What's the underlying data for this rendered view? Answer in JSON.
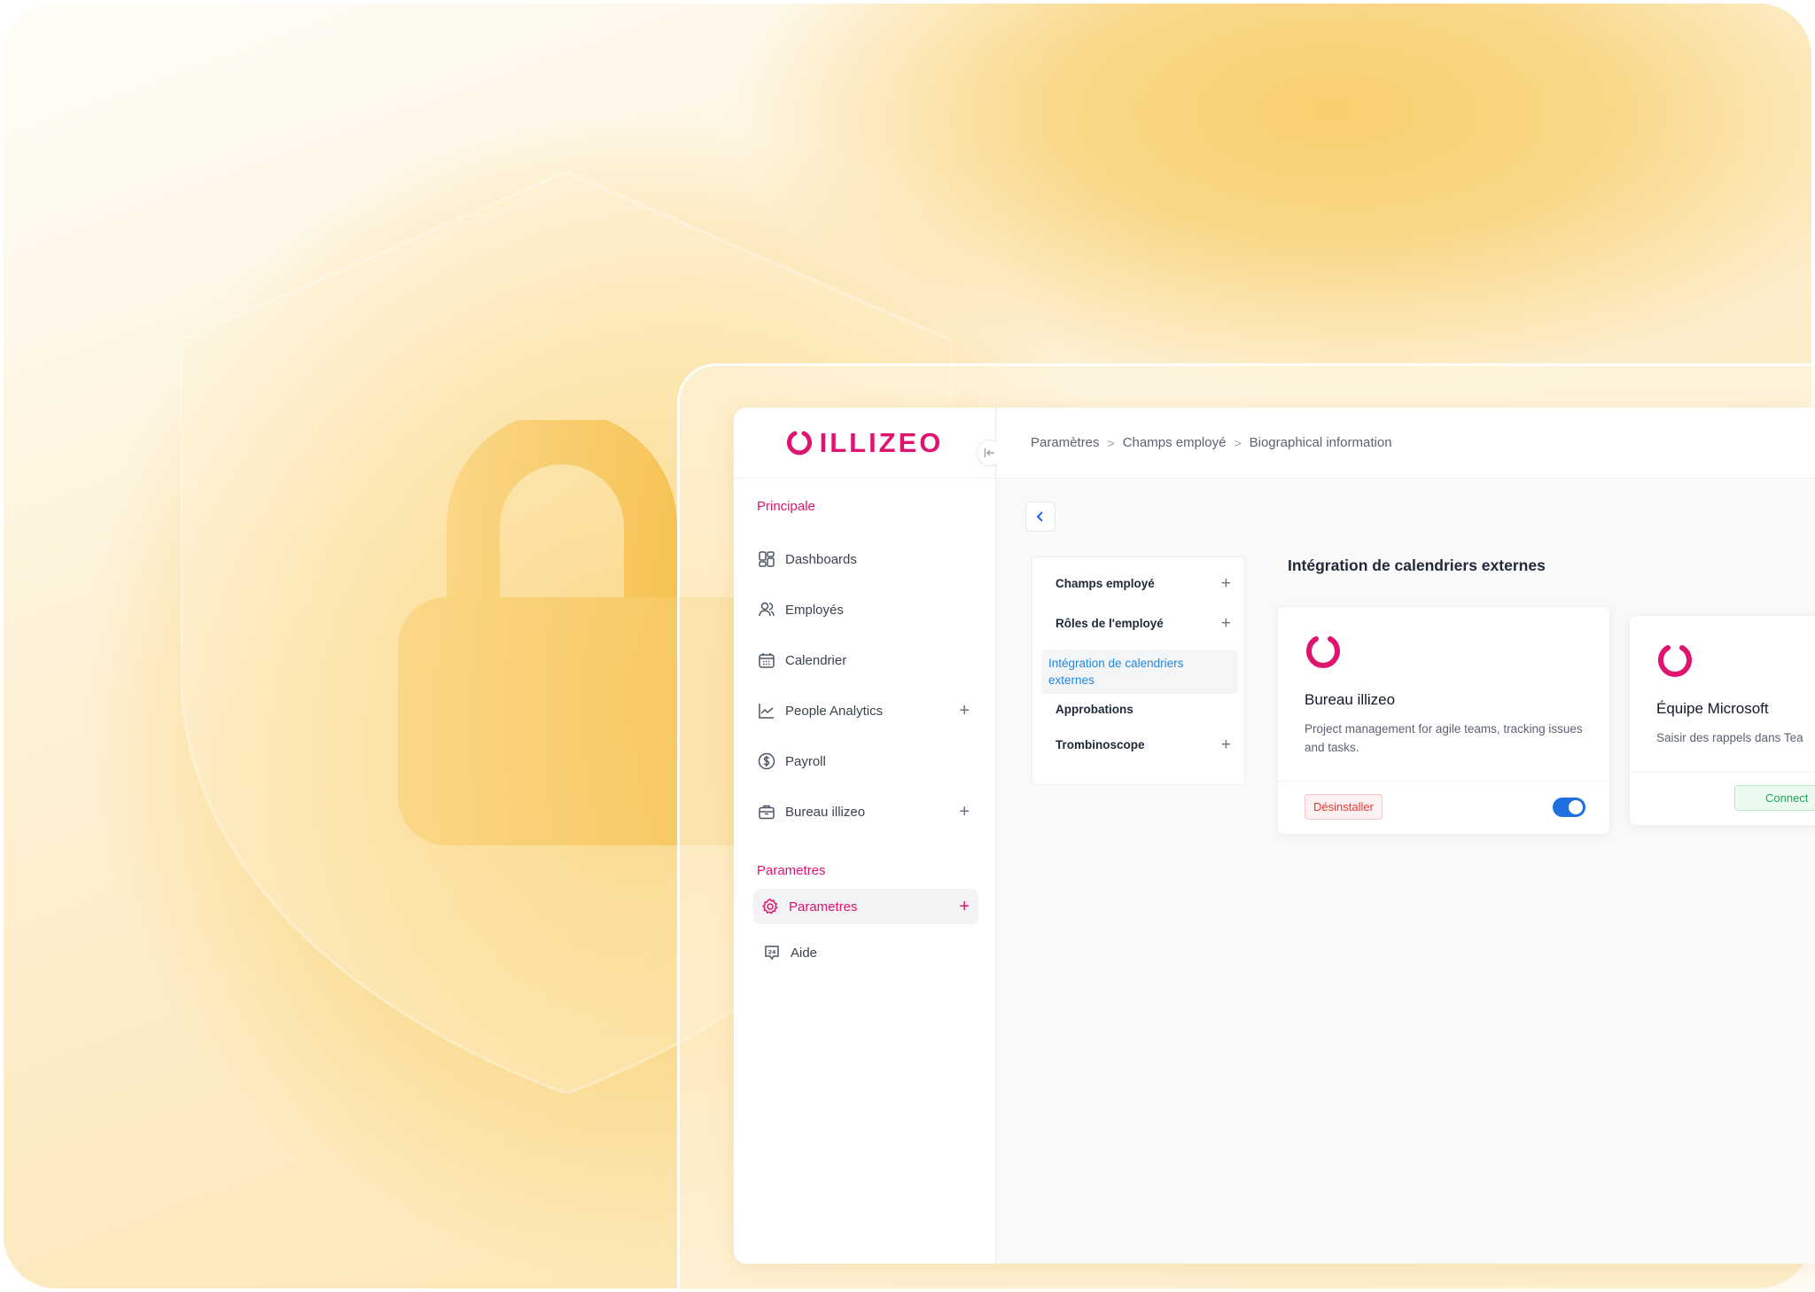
{
  "brand": {
    "logo_text": "ILLIZEO",
    "accent": "#e0136f",
    "link_blue": "#1e88e5"
  },
  "breadcrumb": {
    "items": [
      "Paramètres",
      "Champs employé",
      "Biographical information"
    ],
    "separator": ">"
  },
  "sidebar": {
    "section_principale": "Principale",
    "items": [
      {
        "label": "Dashboards",
        "icon": "dashboard-icon"
      },
      {
        "label": "Employés",
        "icon": "users-icon"
      },
      {
        "label": "Calendrier",
        "icon": "calendar-icon"
      },
      {
        "label": "People Analytics",
        "icon": "chart-icon",
        "expandable": true
      },
      {
        "label": "Payroll",
        "icon": "dollar-icon"
      },
      {
        "label": "Bureau illizeo",
        "icon": "briefcase-icon",
        "expandable": true
      }
    ],
    "section_parametres": "Parametres",
    "param_items": [
      {
        "label": "Parametres",
        "icon": "gear-icon",
        "active": true,
        "expandable": true
      },
      {
        "label": "Aide",
        "icon": "help-24-icon"
      }
    ]
  },
  "submenu": {
    "items": [
      {
        "label": "Champs employé",
        "expandable": true
      },
      {
        "label": "Rôles de l'employé",
        "expandable": true
      },
      {
        "label": "Intégration de calendriers externes",
        "active": true
      },
      {
        "label": "Approbations"
      },
      {
        "label": "Trombinoscope",
        "expandable": true
      }
    ]
  },
  "main": {
    "title": "Intégration de calendriers externes",
    "cards": [
      {
        "title": "Bureau illizeo",
        "description": "Project management for agile teams, tracking issues and tasks.",
        "action_label": "Désinstaller",
        "toggle_on": true
      },
      {
        "title": "Équipe Microsoft",
        "description": "Saisir des rappels dans Tea",
        "action_label": "Connect"
      }
    ]
  }
}
